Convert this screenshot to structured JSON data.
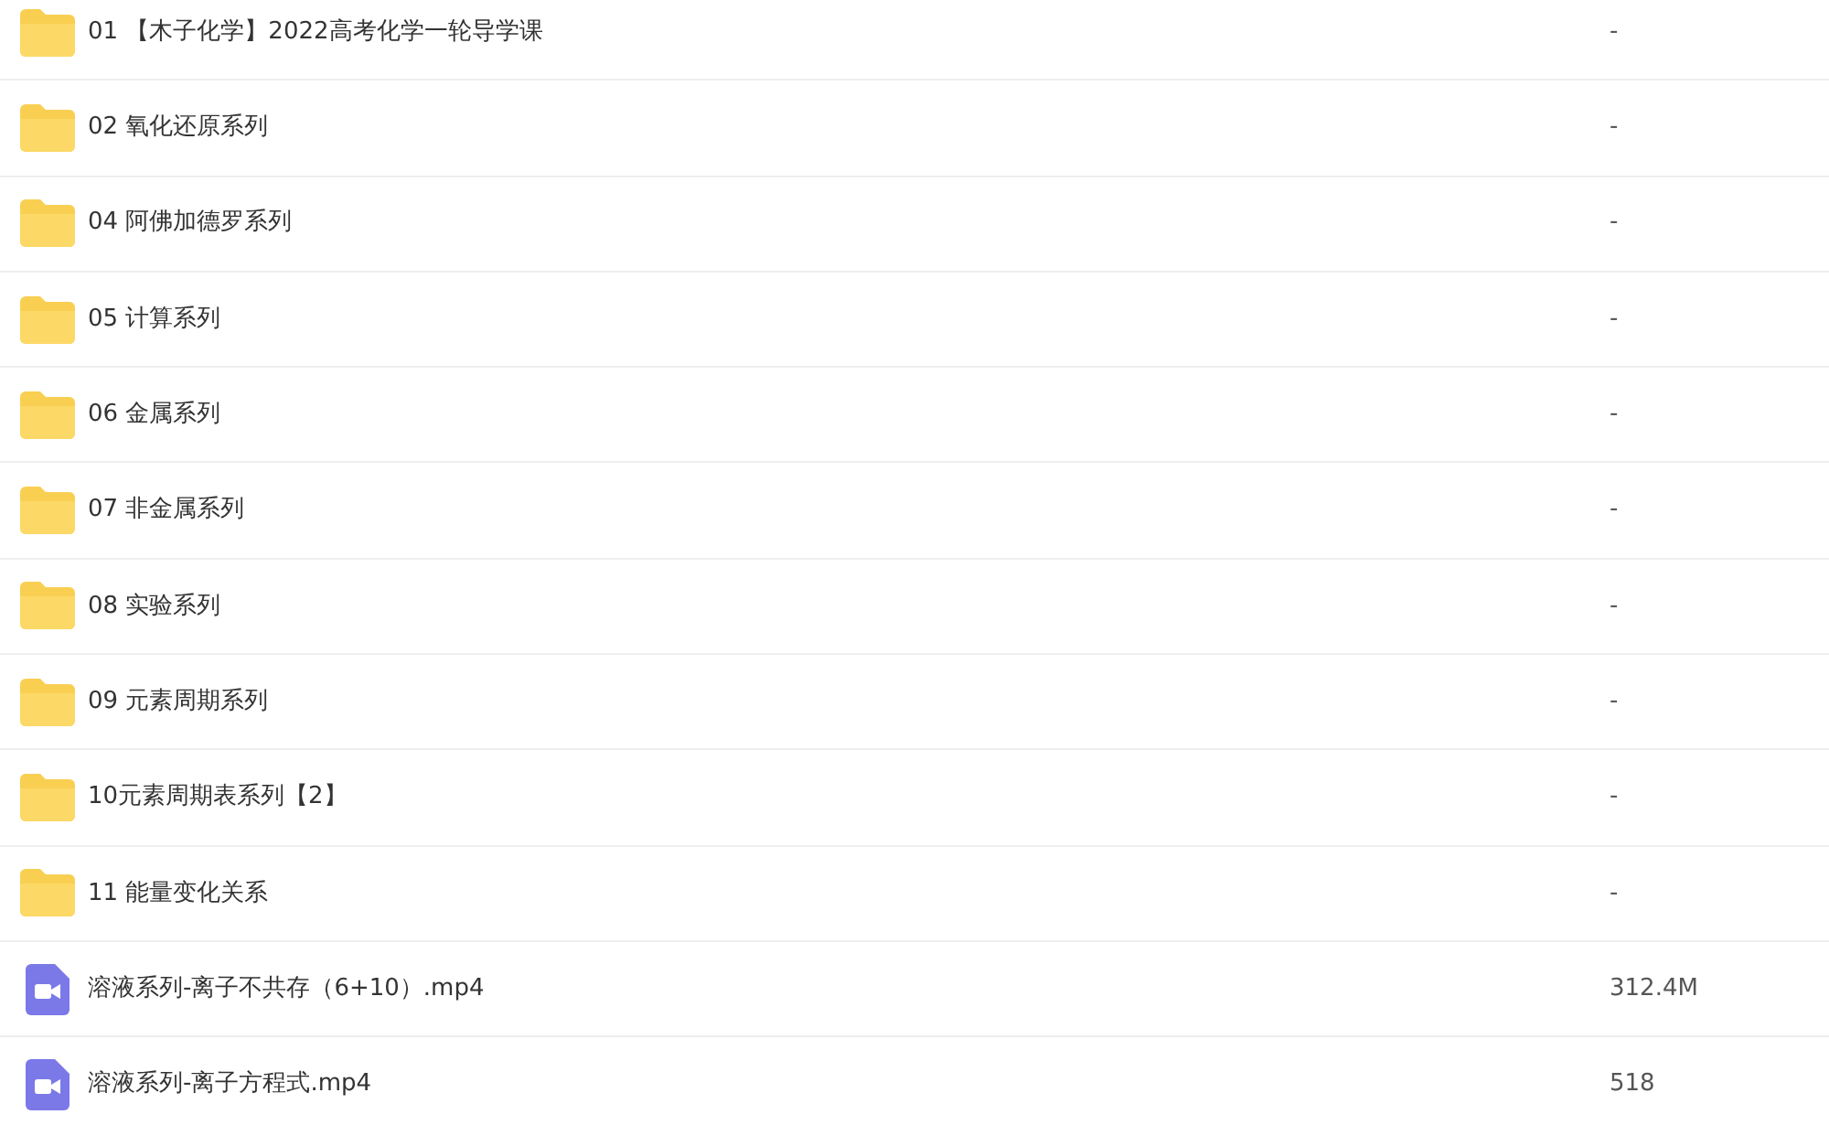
{
  "files": [
    {
      "kind": "folder",
      "name": "01 【木子化学】2022高考化学一轮导学课",
      "size": "-"
    },
    {
      "kind": "folder",
      "name": "02 氧化还原系列",
      "size": "-"
    },
    {
      "kind": "folder",
      "name": "04 阿佛加德罗系列",
      "size": "-"
    },
    {
      "kind": "folder",
      "name": "05 计算系列",
      "size": "-"
    },
    {
      "kind": "folder",
      "name": "06 金属系列",
      "size": "-"
    },
    {
      "kind": "folder",
      "name": "07 非金属系列",
      "size": "-"
    },
    {
      "kind": "folder",
      "name": "08 实验系列",
      "size": "-"
    },
    {
      "kind": "folder",
      "name": "09 元素周期系列",
      "size": "-"
    },
    {
      "kind": "folder",
      "name": "10元素周期表系列【2】",
      "size": "-"
    },
    {
      "kind": "folder",
      "name": "11 能量变化关系",
      "size": "-"
    },
    {
      "kind": "video",
      "name": "溶液系列-离子不共存（6+10）.mp4",
      "size": "312.4M"
    },
    {
      "kind": "video",
      "name": "溶液系列-离子方程式.mp4",
      "size": "518"
    }
  ]
}
